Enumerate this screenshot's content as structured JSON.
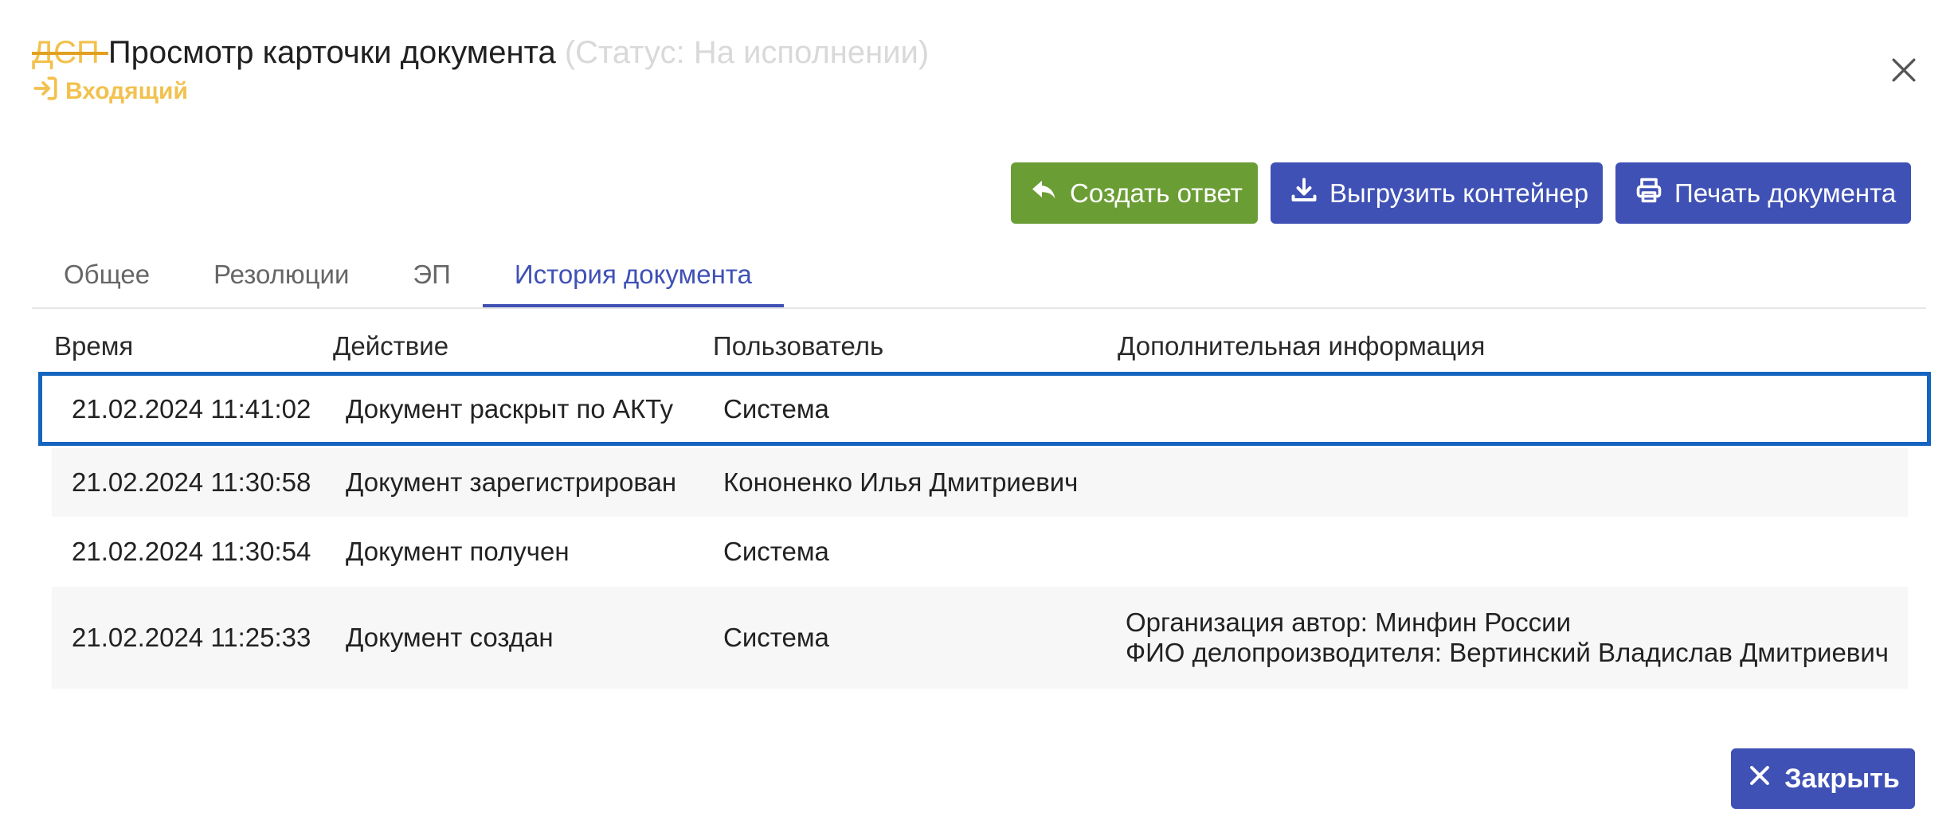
{
  "header": {
    "dsp": "ДСП ",
    "title": "Просмотр карточки документа",
    "status": "(Статус: На исполнении)",
    "incoming_label": "Входящий"
  },
  "actions": {
    "reply_label": "Создать ответ",
    "export_label": "Выгрузить контейнер",
    "print_label": "Печать документа"
  },
  "tabs": [
    {
      "label": "Общее"
    },
    {
      "label": "Резолюции"
    },
    {
      "label": "ЭП"
    },
    {
      "label": "История документа"
    }
  ],
  "table": {
    "columns": [
      "Время",
      "Действие",
      "Пользователь",
      "Дополнительная информация"
    ],
    "rows": [
      {
        "time": "21.02.2024 11:41:02",
        "action": "Документ раскрыт по АКТу",
        "user": "Система",
        "info1": "",
        "info2": ""
      },
      {
        "time": "21.02.2024 11:30:58",
        "action": "Документ зарегистрирован",
        "user": "Кононенко Илья Дмитриевич",
        "info1": "",
        "info2": ""
      },
      {
        "time": "21.02.2024 11:30:54",
        "action": "Документ получен",
        "user": "Система",
        "info1": "",
        "info2": ""
      },
      {
        "time": "21.02.2024 11:25:33",
        "action": "Документ создан",
        "user": "Система",
        "info1": "Организация автор: Минфин России",
        "info2": "ФИО делопроизводителя: Вертинский Владислав Дмитриевич"
      }
    ]
  },
  "footer": {
    "close_label": "Закрыть"
  },
  "colors": {
    "primary": "#3f51b5",
    "success": "#6b9d35",
    "warning": "#f2c14e",
    "selection": "#1565c0"
  }
}
